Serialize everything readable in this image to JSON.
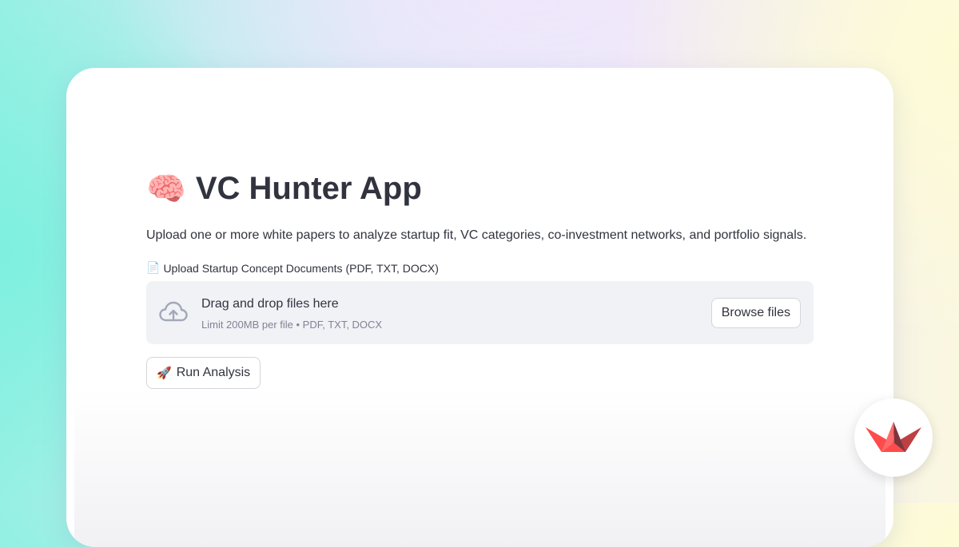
{
  "app": {
    "title_emoji": "🧠",
    "title": "VC Hunter App",
    "description": "Upload one or more white papers to analyze startup fit, VC categories, co-investment networks, and portfolio signals."
  },
  "uploader": {
    "label_emoji": "📄",
    "label": "Upload Startup Concept Documents (PDF, TXT, DOCX)",
    "icon": "cloud-upload-icon",
    "drop_text": "Drag and drop files here",
    "limit_text": "Limit 200MB per file • PDF, TXT, DOCX",
    "browse_label": "Browse files"
  },
  "actions": {
    "run_emoji": "🚀",
    "run_label": "Run Analysis"
  },
  "branding": {
    "logo_icon": "streamlit-logo-icon"
  },
  "colors": {
    "text": "#31333f",
    "muted_text": "#808495",
    "dropzone_bg": "#f0f2f6",
    "brand_red": "#ff4b4b"
  }
}
